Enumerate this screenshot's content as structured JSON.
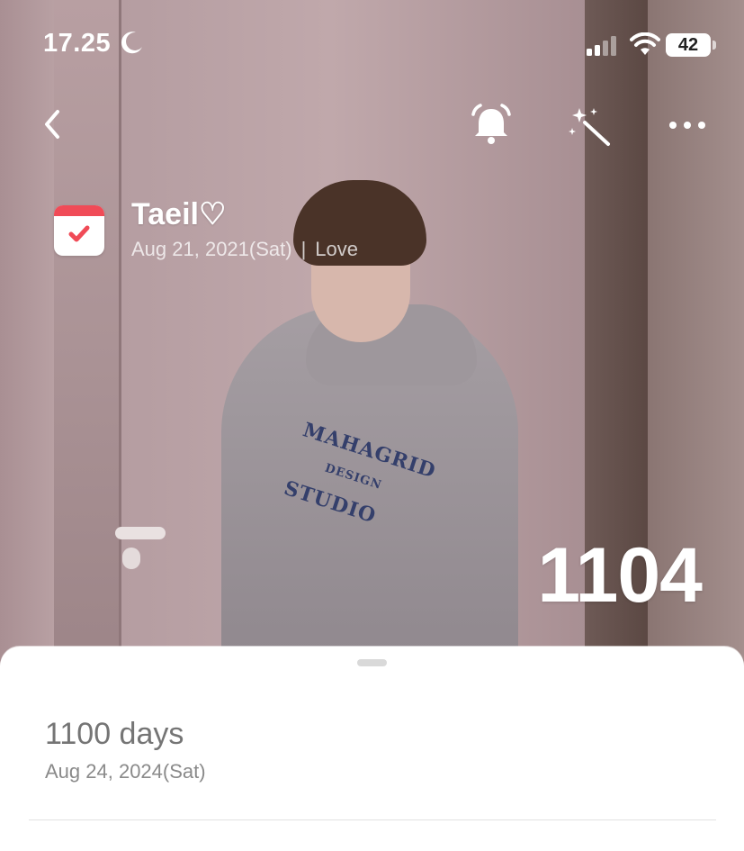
{
  "status_bar": {
    "time": "17.25",
    "battery": "42",
    "icons": [
      "moon-icon",
      "signal-icon",
      "wifi-icon",
      "battery-icon"
    ]
  },
  "nav": {
    "icons": [
      "back-chevron-icon",
      "alarm-bell-icon",
      "magic-wand-icon",
      "more-dots-icon"
    ]
  },
  "event": {
    "title": "Taeil♡",
    "date": "Aug 21, 2021(Sat)",
    "separator": "|",
    "category": "Love",
    "icon": "calendar-check-icon",
    "accent_color": "#f04b57"
  },
  "day_count": "1104",
  "milestones": [
    {
      "title": "1100 days",
      "date": "Aug 24, 2024(Sat)"
    }
  ],
  "photo_print": [
    "MAHAGRID",
    "DESIGN",
    "STUDIO"
  ]
}
